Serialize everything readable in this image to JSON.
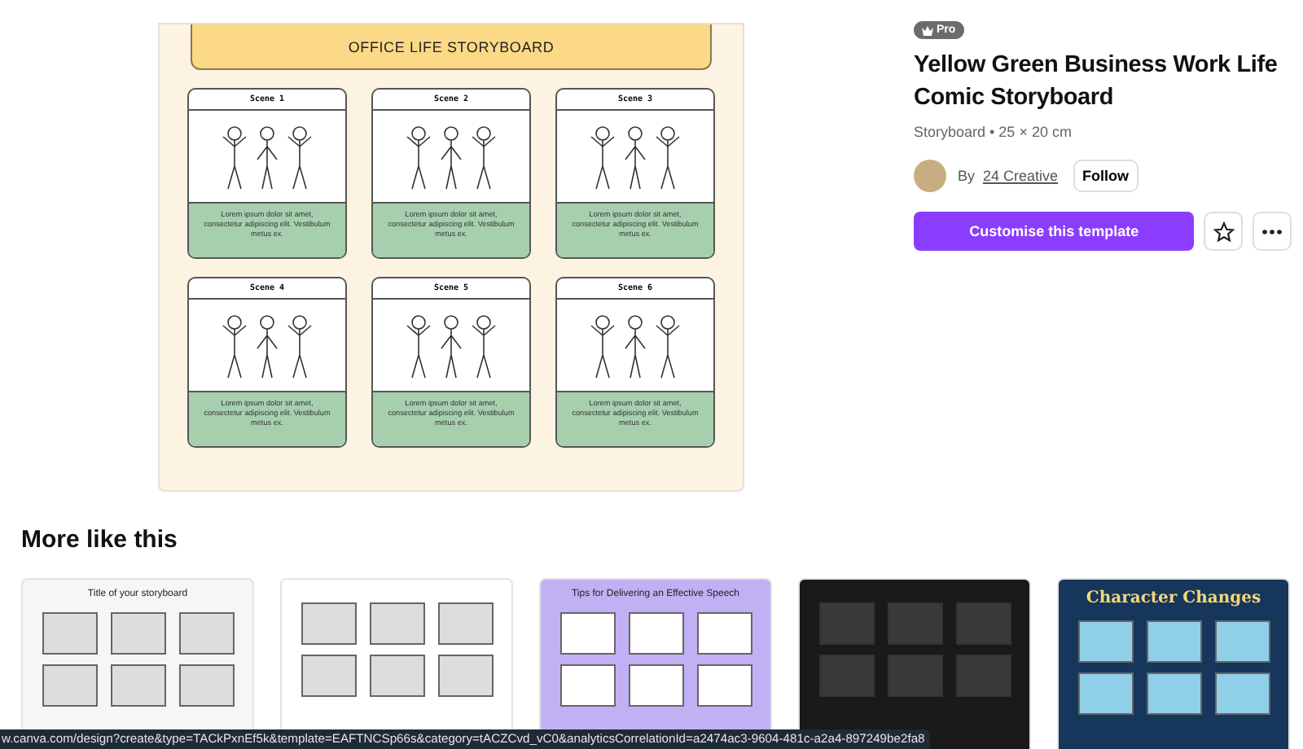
{
  "preview": {
    "title": "OFFICE LIFE STORYBOARD",
    "scenes": [
      {
        "label": "Scene 1",
        "caption": "Lorem ipsum dolor sit amet, consectetur adipiscing elit. Vestibulum metus ex."
      },
      {
        "label": "Scene 2",
        "caption": "Lorem ipsum dolor sit amet, consectetur adipiscing elit. Vestibulum metus ex."
      },
      {
        "label": "Scene 3",
        "caption": "Lorem ipsum dolor sit amet, consectetur adipiscing elit. Vestibulum metus ex."
      },
      {
        "label": "Scene 4",
        "caption": "Lorem ipsum dolor sit amet, consectetur adipiscing elit. Vestibulum metus ex."
      },
      {
        "label": "Scene 5",
        "caption": "Lorem ipsum dolor sit amet, consectetur adipiscing elit. Vestibulum metus ex."
      },
      {
        "label": "Scene 6",
        "caption": "Lorem ipsum dolor sit amet, consectetur adipiscing elit. Vestibulum metus ex."
      }
    ]
  },
  "details": {
    "badge": "Pro",
    "title": "Yellow Green Business Work Life Comic Storyboard",
    "meta": "Storyboard • 25 × 20 cm",
    "author_prefix": "By",
    "author": "24 Creative",
    "follow": "Follow",
    "primary_button": "Customise this template"
  },
  "more": {
    "heading": "More like this",
    "items": [
      {
        "kind": "sketch",
        "title": "Title of your storyboard"
      },
      {
        "kind": "form"
      },
      {
        "kind": "purple",
        "title": "Tips for Delivering an Effective Speech"
      },
      {
        "kind": "dark"
      },
      {
        "kind": "navy",
        "title": "Character Changes"
      }
    ]
  },
  "status_url": "w.canva.com/design?create&type=TACkPxnEf5k&template=EAFTNCSp66s&category=tACZCvd_vC0&analyticsCorrelationId=a2474ac3-9604-481c-a2a4-897249be2fa8"
}
